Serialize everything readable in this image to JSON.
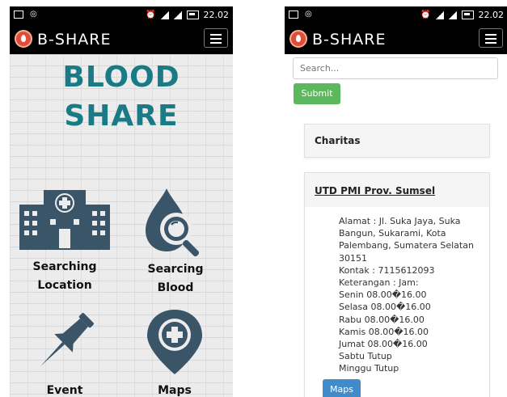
{
  "status_bar": {
    "time": "22.02"
  },
  "app": {
    "brand": "B-SHARE"
  },
  "home": {
    "title_line1": "BLOOD",
    "title_line2": "SHARE",
    "menu": [
      {
        "line1": "Searching",
        "line2": "Location",
        "icon": "hospital-icon"
      },
      {
        "line1": "Searcing",
        "line2": "Blood",
        "icon": "blood-search-icon"
      },
      {
        "line1": "Event",
        "line2": "",
        "icon": "pushpin-icon"
      },
      {
        "line1": "Maps",
        "line2": "",
        "icon": "map-pin-plus-icon"
      }
    ]
  },
  "search_page": {
    "search_placeholder": "Search...",
    "submit_label": "Submit",
    "results": [
      {
        "name": "Charitas"
      },
      {
        "name": "UTD PMI Prov. Sumsel",
        "details": [
          "Alamat : Jl. Suka Jaya, Suka",
          "Bangun, Sukarami, Kota",
          "Palembang, Sumatera Selatan",
          "30151",
          "Kontak : 7115612093",
          "Keterangan : Jam:",
          "Senin 08.00�16.00",
          "Selasa 08.00�16.00",
          "Rabu 08.00�16.00",
          "Kamis 08.00�16.00",
          "Jumat 08.00�16.00",
          "Sabtu Tutup",
          "Minggu Tutup"
        ],
        "maps_label": "Maps"
      }
    ]
  },
  "colors": {
    "title": "#1a7a85",
    "icon": "#3a5468",
    "submit": "#5cb85c",
    "maps_button": "#428bca",
    "brand_icon": "#e14d3b"
  }
}
